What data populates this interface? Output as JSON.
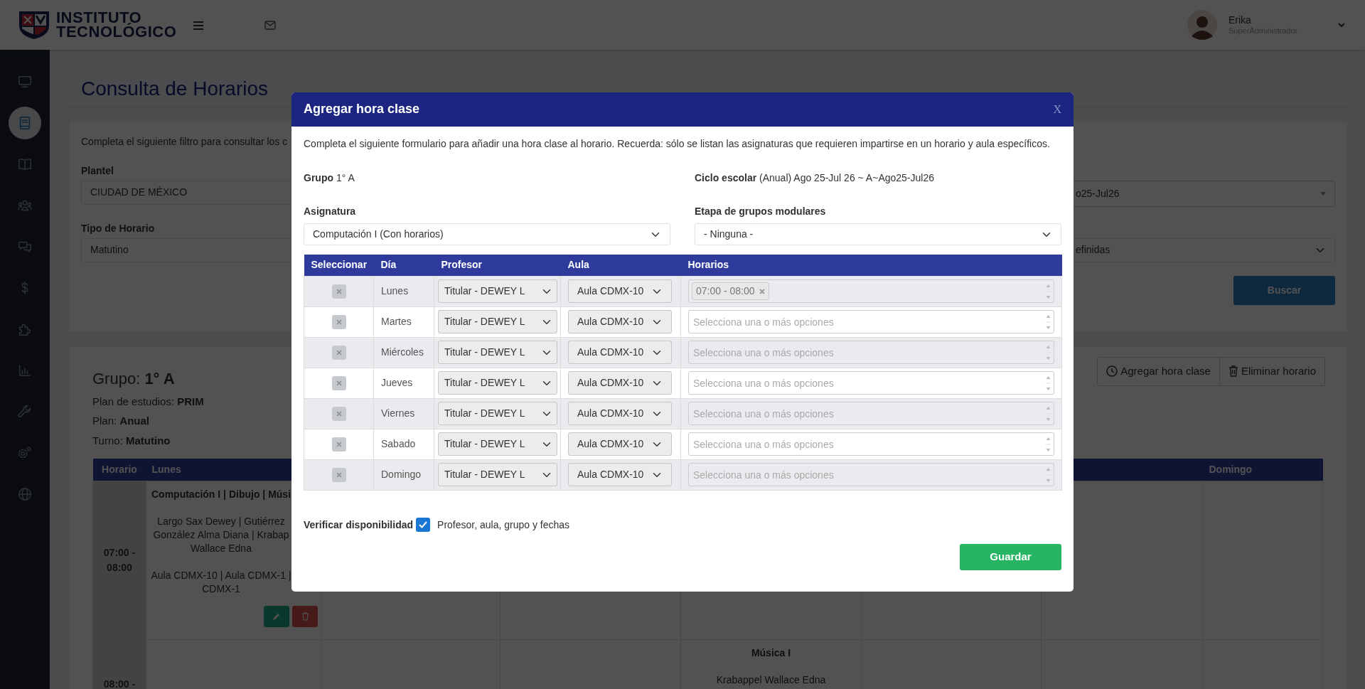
{
  "header": {
    "logo_lines": [
      "INSTITUTO",
      "TECNOLÓGICO"
    ],
    "user": {
      "name": "Erika",
      "role": "SuperAdministrador"
    }
  },
  "sidebar": {
    "items": [
      {
        "kind": "monitor",
        "selected": false
      },
      {
        "kind": "book",
        "selected": true
      },
      {
        "kind": "open-book",
        "selected": false
      },
      {
        "kind": "people",
        "selected": false
      },
      {
        "kind": "chat",
        "selected": false
      },
      {
        "kind": "dollar",
        "selected": false
      },
      {
        "kind": "puzzle",
        "selected": false
      },
      {
        "kind": "bar-chart",
        "selected": false
      },
      {
        "kind": "wrench",
        "selected": false
      },
      {
        "kind": "gears",
        "selected": false
      },
      {
        "kind": "globe",
        "selected": false
      }
    ]
  },
  "page": {
    "title": "Consulta de Horarios"
  },
  "filter": {
    "intro": "Completa el siguiente filtro para consultar los c",
    "left_fields": [
      {
        "label": "Plantel",
        "value": "CIUDAD DE MÉXICO"
      },
      {
        "label": "Tipo de Horario",
        "value": "Matutino"
      }
    ],
    "right_fields": [
      {
        "kind": "search-select",
        "value": "o25-Jul26"
      },
      {
        "kind": "select",
        "value": "efinidas"
      }
    ],
    "button": "Buscar"
  },
  "schedule": {
    "group": {
      "label": "Grupo:",
      "value": "1° A"
    },
    "info": [
      {
        "label": "Plan de estudios:",
        "value": "PRIM"
      },
      {
        "label": "Plan:",
        "value": "Anual"
      },
      {
        "label": "Turno:",
        "value": "Matutino"
      }
    ],
    "buttons": [
      {
        "kind": "clock",
        "label": "Agregar hora clase"
      },
      {
        "kind": "trash",
        "label": "Eliminar horario"
      }
    ],
    "columns": [
      "Horario",
      "Lunes",
      null,
      null,
      null,
      null,
      null,
      "Domingo"
    ],
    "rows": [
      {
        "cells": [
          "07:00 - 08:00",
          {
            "subject": "Computación I | Dibujo | Músi",
            "teacher_lines": [
              "Largo Sax Dewey | Gutiérrez",
              "González Alma Diana | Krabap",
              "Wallace Edna"
            ],
            "room_lines": [
              "Aula CDMX-10 | Aula CDMX-1 |",
              "CDMX-1"
            ],
            "actions": [
              {
                "kind": "edit"
              },
              {
                "kind": "delete"
              }
            ]
          },
          null,
          null,
          null,
          null,
          null,
          null
        ]
      },
      {
        "cells": [
          "08:00 -",
          null,
          null,
          null,
          {
            "subject": "Música I",
            "teacher_lines": [
              "Krabappel Wallace Edna"
            ]
          },
          null,
          null,
          null
        ]
      }
    ]
  },
  "modal": {
    "title": "Agregar hora clase",
    "close": "X",
    "intro": "Completa el siguiente formulario para añadir una hora clase al horario. Recuerda: sólo se listan las asignaturas que requieren impartirse en un horario y aula específicos.",
    "info": [
      {
        "label": "Grupo",
        "value": "1° A"
      },
      {
        "label": "Ciclo escolar",
        "value": "(Anual) Ago 25-Jul 26 ~ A~Ago25-Jul26"
      }
    ],
    "fields": [
      {
        "label": "Asignatura",
        "value": "Computación I (Con horarios)"
      },
      {
        "label": "Etapa de grupos modulares",
        "value": "- Ninguna -"
      }
    ],
    "table": {
      "columns": [
        "Seleccionar",
        "Día",
        "Profesor",
        "Aula",
        "Horarios"
      ],
      "rows": [
        {
          "checked": false,
          "day": "Lunes",
          "teacher": "Titular - DEWEY L",
          "room": "Aula CDMX-10",
          "tags": [
            "07:00 - 08:00"
          ]
        },
        {
          "checked": false,
          "day": "Martes",
          "teacher": "Titular - DEWEY L",
          "room": "Aula CDMX-10",
          "placeholder": "Selecciona una o más opciones"
        },
        {
          "checked": false,
          "day": "Miércoles",
          "teacher": "Titular - DEWEY L",
          "room": "Aula CDMX-10",
          "placeholder": "Selecciona una o más opciones"
        },
        {
          "checked": false,
          "day": "Jueves",
          "teacher": "Titular - DEWEY L",
          "room": "Aula CDMX-10",
          "placeholder": "Selecciona una o más opciones"
        },
        {
          "checked": false,
          "day": "Viernes",
          "teacher": "Titular - DEWEY L",
          "room": "Aula CDMX-10",
          "placeholder": "Selecciona una o más opciones"
        },
        {
          "checked": false,
          "day": "Sabado",
          "teacher": "Titular - DEWEY L",
          "room": "Aula CDMX-10",
          "placeholder": "Selecciona una o más opciones"
        },
        {
          "checked": false,
          "day": "Domingo",
          "teacher": "Titular - DEWEY L",
          "room": "Aula CDMX-10",
          "placeholder": "Selecciona una o más opciones"
        }
      ]
    },
    "verify": {
      "label": "Verificar disponibilidad",
      "checked": true,
      "note": "Profesor, aula, grupo y fechas"
    },
    "save": "Guardar"
  }
}
